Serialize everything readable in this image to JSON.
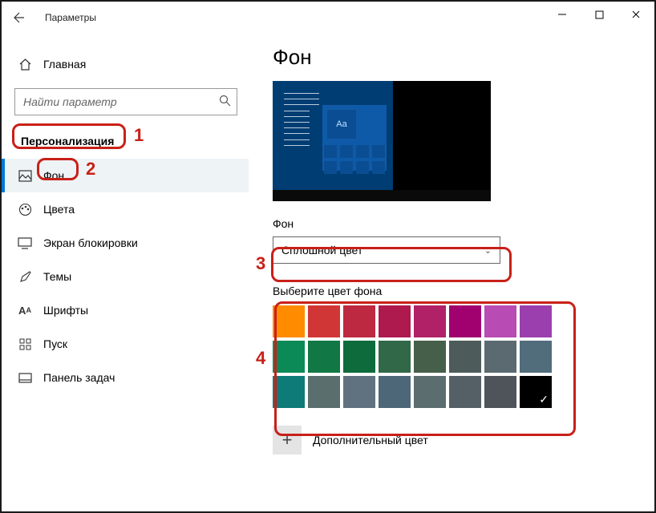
{
  "window": {
    "title": "Параметры"
  },
  "sidebar": {
    "home": "Главная",
    "searchPlaceholder": "Найти параметр",
    "section": "Персонализация",
    "items": [
      {
        "label": "Фон"
      },
      {
        "label": "Цвета"
      },
      {
        "label": "Экран блокировки"
      },
      {
        "label": "Темы"
      },
      {
        "label": "Шрифты"
      },
      {
        "label": "Пуск"
      },
      {
        "label": "Панель задач"
      }
    ]
  },
  "main": {
    "heading": "Фон",
    "backgroundLabel": "Фон",
    "backgroundSelected": "Сплошной цвет",
    "pickerLabel": "Выберите цвет фона",
    "previewAa": "Aa",
    "customColor": "Дополнительный цвет"
  },
  "annotations": {
    "n1": "1",
    "n2": "2",
    "n3": "3",
    "n4": "4"
  },
  "swatches": [
    "#ff8c00",
    "#d13636",
    "#bd2940",
    "#ae194e",
    "#b12167",
    "#a1006f",
    "#b84bb4",
    "#9b3fae",
    "#0b8a57",
    "#117744",
    "#0d6b3c",
    "#306848",
    "#465f4a",
    "#4d5b5a",
    "#5a6a70",
    "#516d7c",
    "#0f7b78",
    "#5a6e6e",
    "#607280",
    "#4e6778",
    "#5b6d6f",
    "#556066",
    "#4e5459",
    "#000000"
  ],
  "selectedSwatchIndex": 23
}
